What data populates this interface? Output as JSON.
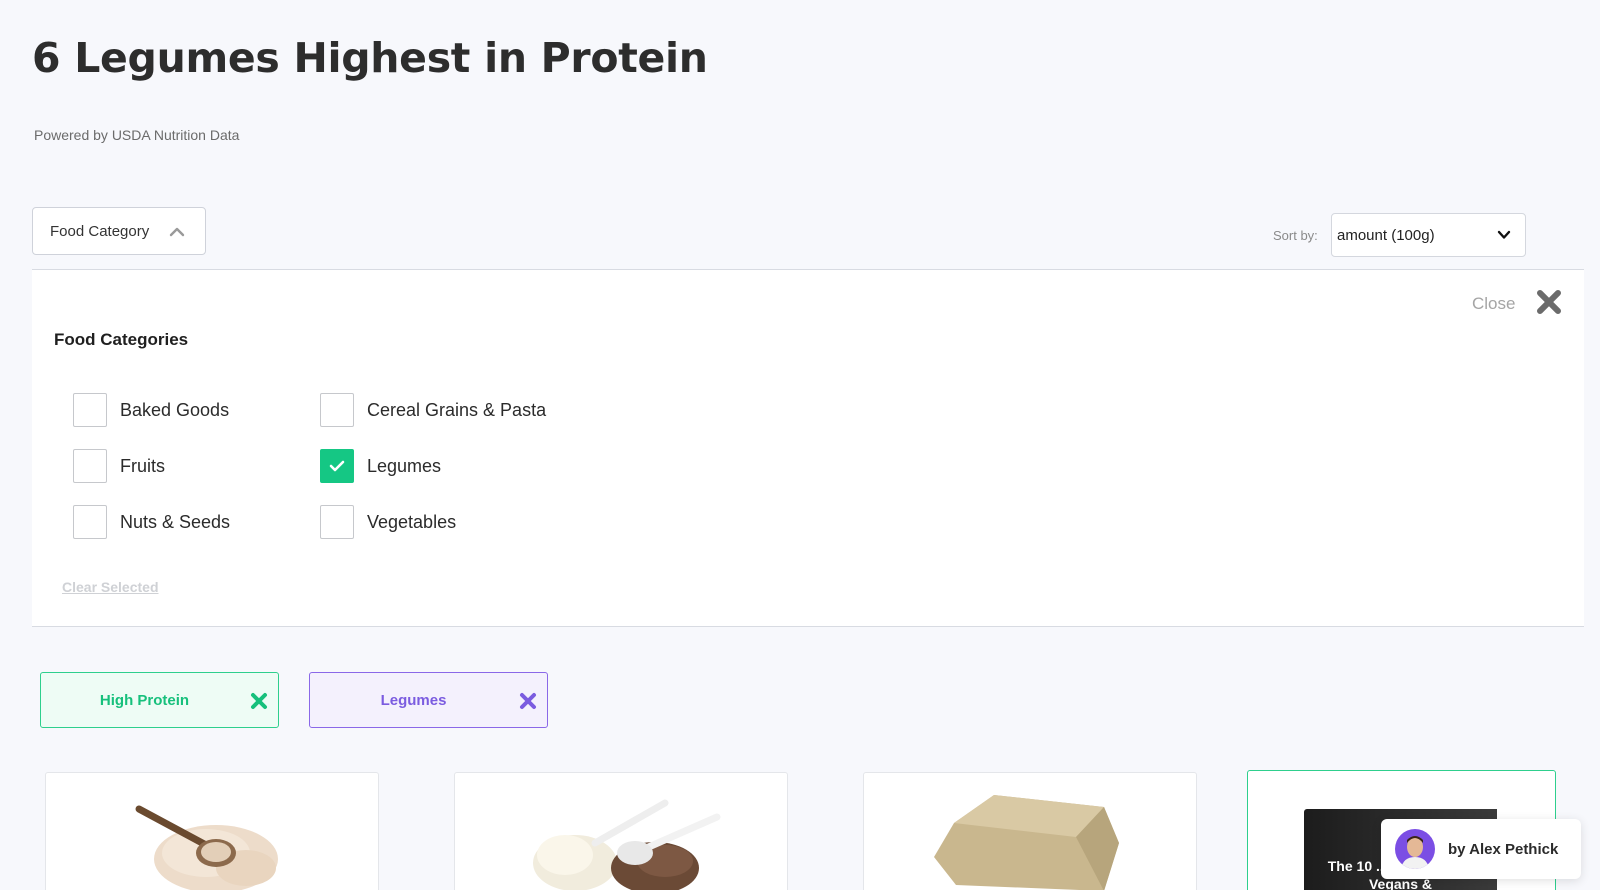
{
  "header": {
    "title": "6 Legumes Highest in Protein",
    "powered_by": "Powered by USDA Nutrition Data"
  },
  "filters": {
    "category_dropdown_label": "Food Category",
    "sort_label": "Sort by:",
    "sort_value": "amount (100g)"
  },
  "panel": {
    "close_label": "Close",
    "heading": "Food Categories",
    "categories": [
      {
        "label": "Baked Goods",
        "checked": false
      },
      {
        "label": "Cereal Grains & Pasta",
        "checked": false
      },
      {
        "label": "Fruits",
        "checked": false
      },
      {
        "label": "Legumes",
        "checked": true
      },
      {
        "label": "Nuts & Seeds",
        "checked": false
      },
      {
        "label": "Vegetables",
        "checked": false
      }
    ],
    "clear_label": "Clear Selected"
  },
  "chips": [
    {
      "label": "High Protein",
      "color": "#17c07c"
    },
    {
      "label": "Legumes",
      "color": "#7b5ce0"
    }
  ],
  "promo": {
    "book_title": "The 10 ... Sources For Vegans &"
  },
  "author": {
    "name": "by Alex Pethick"
  },
  "colors": {
    "accent_green": "#15c784",
    "accent_purple": "#7b5ce0"
  }
}
